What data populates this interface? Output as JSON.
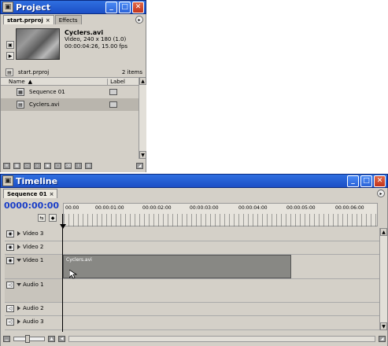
{
  "project_window": {
    "title": "Project",
    "tabs": [
      {
        "label": "start.prproj"
      },
      {
        "label": "Effects"
      }
    ],
    "preview": {
      "clip_name": "Cyclers.avi",
      "line1": "Video, 240 x 180 (1.0)",
      "line2": "00:00:04:26, 15.00 fps"
    },
    "path_label": "start.prproj",
    "item_count": "2 items",
    "columns": {
      "name": "Name",
      "label": "Label"
    },
    "items": [
      {
        "name": "Sequence 01"
      },
      {
        "name": "Cyclers.avi"
      }
    ]
  },
  "timeline_window": {
    "title": "Timeline",
    "tab_label": "Sequence 01",
    "timecode": "0000:00:00",
    "ruler_labels": [
      "00:00",
      "00:00:01:00",
      "00:00:02:00",
      "00:00:03:00",
      "00:00:04:00",
      "00:00:05:00",
      "00:00:06:00"
    ],
    "tracks": [
      {
        "name": "Video 3"
      },
      {
        "name": "Video 2"
      },
      {
        "name": "Video 1"
      },
      {
        "name": "Audio 1"
      },
      {
        "name": "Audio 2"
      },
      {
        "name": "Audio 3"
      }
    ],
    "clip_label": "Cyclers.avi"
  },
  "colors": {
    "titlebar": "#1c4fc6",
    "panel": "#d4d0c8",
    "timecode": "#1a3ec8"
  }
}
